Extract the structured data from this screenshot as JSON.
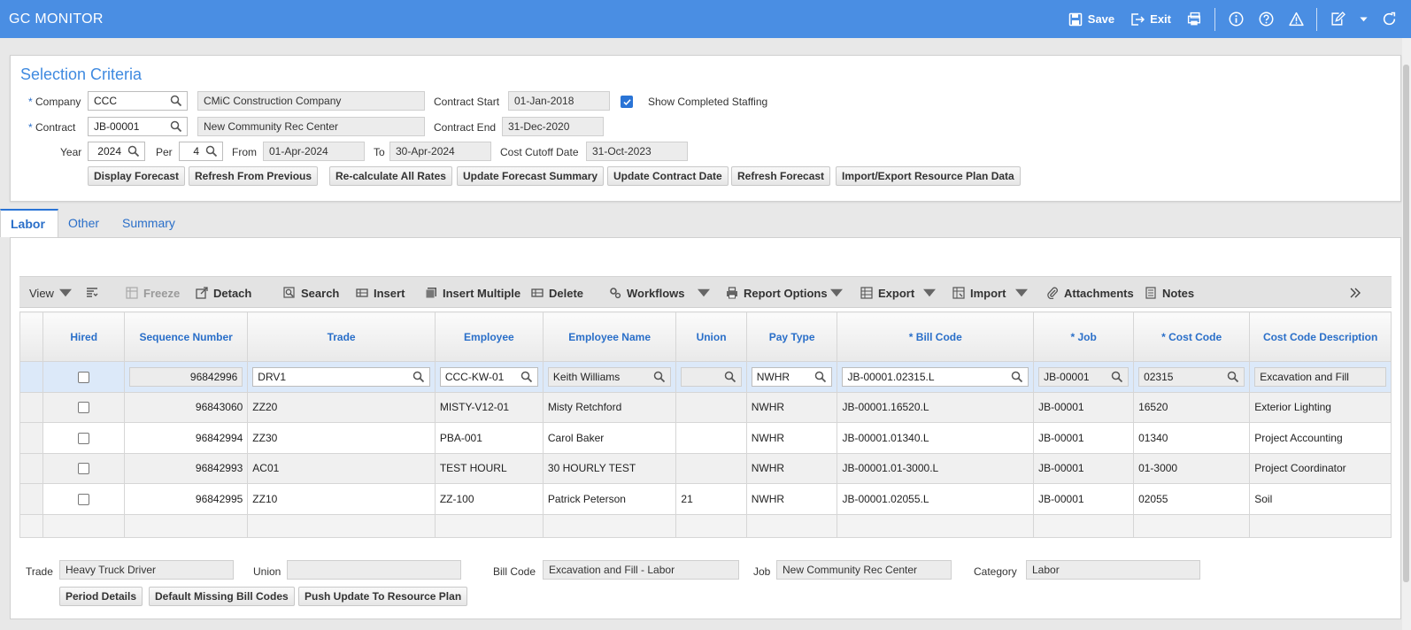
{
  "header": {
    "title": "GC MONITOR",
    "save_label": "Save",
    "exit_label": "Exit",
    "bg_color": "#4a8ee3"
  },
  "selection": {
    "title": "Selection Criteria",
    "company": {
      "label": "Company",
      "value": "CCC",
      "name": "CMiC Construction Company"
    },
    "contract": {
      "label": "Contract",
      "value": "JB-00001",
      "name": "New Community Rec Center"
    },
    "contract_start": {
      "label": "Contract Start",
      "value": "01-Jan-2018"
    },
    "contract_end": {
      "label": "Contract End",
      "value": "31-Dec-2020"
    },
    "show_completed": {
      "label": "Show Completed Staffing",
      "checked": true
    },
    "year": {
      "label": "Year",
      "value": "2024"
    },
    "per": {
      "label": "Per",
      "value": "4"
    },
    "from": {
      "label": "From",
      "value": "01-Apr-2024"
    },
    "to": {
      "label": "To",
      "value": "30-Apr-2024"
    },
    "cost_cutoff": {
      "label": "Cost Cutoff Date",
      "value": "31-Oct-2023"
    },
    "buttons": {
      "display_forecast": "Display Forecast",
      "refresh_from_previous": "Refresh From Previous",
      "recalculate": "Re-calculate All Rates",
      "update_forecast_summary": "Update Forecast Summary",
      "update_contract_date": "Update Contract Date",
      "refresh_forecast": "Refresh Forecast",
      "import_export": "Import/Export Resource Plan Data"
    }
  },
  "tabs": [
    "Labor",
    "Other",
    "Summary"
  ],
  "toolbar": {
    "view": "View",
    "freeze": "Freeze",
    "detach": "Detach",
    "search": "Search",
    "insert": "Insert",
    "insert_multiple": "Insert Multiple",
    "delete": "Delete",
    "workflows": "Workflows",
    "report_options": "Report Options",
    "export": "Export",
    "import": "Import",
    "attachments": "Attachments",
    "notes": "Notes"
  },
  "grid": {
    "columns": [
      "Hired",
      "Sequence Number",
      "Trade",
      "Employee",
      "Employee Name",
      "Union",
      "Pay Type",
      "* Bill Code",
      "* Job",
      "* Cost Code",
      "Cost Code Description"
    ],
    "rows": [
      {
        "seq": "96842996",
        "trade": "DRV1",
        "employee": "CCC-KW-01",
        "name": "Keith Williams",
        "union": "",
        "pay": "NWHR",
        "bill": "JB-00001.02315.L",
        "job": "JB-00001",
        "cost": "02315",
        "desc": "Excavation and Fill"
      },
      {
        "seq": "96843060",
        "trade": "ZZ20",
        "employee": "MISTY-V12-01",
        "name": "Misty Retchford",
        "union": "",
        "pay": "NWHR",
        "bill": "JB-00001.16520.L",
        "job": "JB-00001",
        "cost": "16520",
        "desc": "Exterior Lighting"
      },
      {
        "seq": "96842994",
        "trade": "ZZ30",
        "employee": "PBA-001",
        "name": "Carol Baker",
        "union": "",
        "pay": "NWHR",
        "bill": "JB-00001.01340.L",
        "job": "JB-00001",
        "cost": "01340",
        "desc": "Project Accounting"
      },
      {
        "seq": "96842993",
        "trade": "AC01",
        "employee": "TEST HOURL",
        "name": "30 HOURLY TEST",
        "union": "",
        "pay": "NWHR",
        "bill": "JB-00001.01-3000.L",
        "job": "JB-00001",
        "cost": "01-3000",
        "desc": "Project Coordinator"
      },
      {
        "seq": "96842995",
        "trade": "ZZ10",
        "employee": "ZZ-100",
        "name": "Patrick Peterson",
        "union": "21",
        "pay": "NWHR",
        "bill": "JB-00001.02055.L",
        "job": "JB-00001",
        "cost": "02055",
        "desc": "Soil"
      }
    ]
  },
  "detail": {
    "trade": {
      "label": "Trade",
      "value": "Heavy Truck Driver"
    },
    "union": {
      "label": "Union",
      "value": ""
    },
    "bill_code": {
      "label": "Bill Code",
      "value": "Excavation and Fill - Labor"
    },
    "job": {
      "label": "Job",
      "value": "New Community Rec Center"
    },
    "category": {
      "label": "Category",
      "value": "Labor"
    },
    "buttons": {
      "period_details": "Period Details",
      "default_missing": "Default Missing Bill Codes",
      "push_update": "Push Update To Resource Plan"
    }
  }
}
